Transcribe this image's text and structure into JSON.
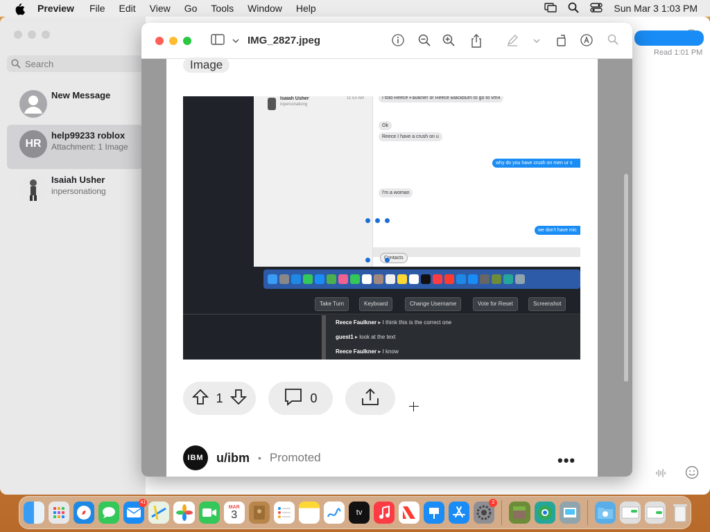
{
  "menubar": {
    "app_name": "Preview",
    "items": [
      "File",
      "Edit",
      "View",
      "Go",
      "Tools",
      "Window",
      "Help"
    ],
    "clock": "Sun Mar 3  1:03 PM"
  },
  "messages": {
    "search_placeholder": "Search",
    "conversations": [
      {
        "title": "New Message",
        "subtitle": ""
      },
      {
        "title": "help99233 roblox",
        "subtitle": "Attachment: 1 Image",
        "initials": "HR"
      },
      {
        "title": "Isaiah Usher",
        "subtitle": "inpersonationg"
      }
    ],
    "read_receipt": "Read 1:01 PM"
  },
  "preview": {
    "filename": "IMG_2827.jpeg",
    "tag_label": "Image",
    "screenshot": {
      "contact_name": "Isaiah Usher",
      "contact_sub": "inpersonationg",
      "contact_time": "11:53 AM",
      "bubbles": [
        {
          "text": "I told Reece Faulkner or Reece Blackburn to go to vm4",
          "side": "gray"
        },
        {
          "text": "Ok",
          "side": "gray"
        },
        {
          "text": "Reece I have a crush on u",
          "side": "gray"
        },
        {
          "text": "why do you have crush  on men ur s",
          "side": "blue"
        },
        {
          "text": "I'm a woman",
          "side": "gray"
        },
        {
          "text": "we don't have mic",
          "side": "blue"
        }
      ],
      "contacts_label": "Contacts",
      "buttons": [
        "Take Turn",
        "Keyboard",
        "Change Username",
        "Vote for Reset",
        "Screenshot"
      ],
      "log": [
        {
          "user": "Reece Faulkner",
          "text": "I think this is the correct one"
        },
        {
          "user": "guest1",
          "text": "look at the text"
        },
        {
          "user": "Reece Faulkner",
          "text": "I know"
        }
      ]
    },
    "actions": {
      "upvotes": "1",
      "comments": "0"
    },
    "promo": {
      "logo_text": "IBM",
      "user": "u/ibm",
      "separator": "•",
      "label": "Promoted",
      "more": "•••"
    }
  },
  "dock": {
    "mail_badge": "41",
    "calendar_month": "MAR",
    "calendar_day": "3",
    "settings_badge": "2",
    "tv_label": "tv"
  },
  "colors": {
    "accent": "#1a8cf5",
    "menubar": "#ececec",
    "sidebar": "#e9e9ea"
  }
}
